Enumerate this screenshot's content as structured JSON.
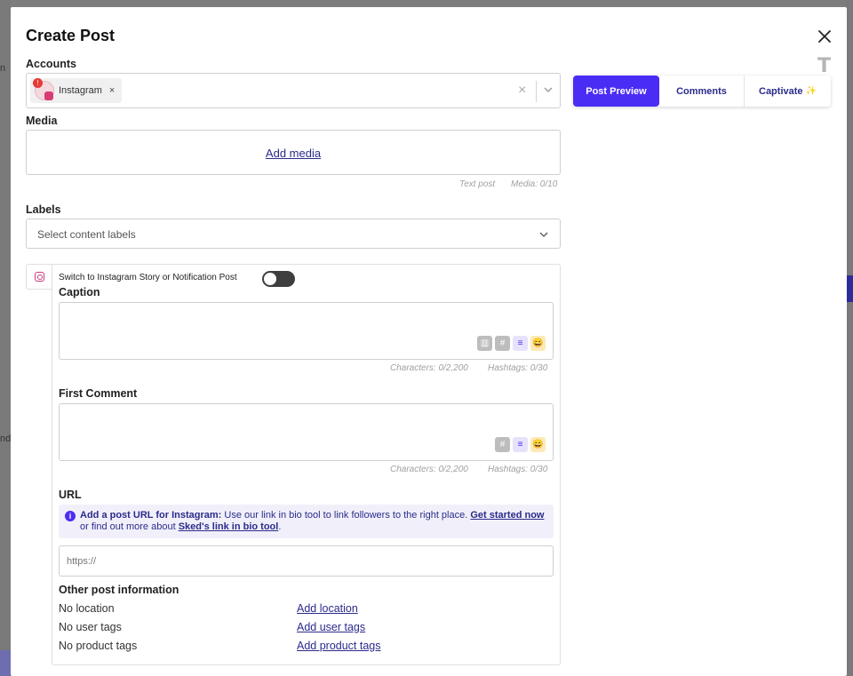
{
  "background": {
    "left_fragments": [
      "n",
      "nd"
    ]
  },
  "modal": {
    "title": "Create Post",
    "close_icon": "close-icon",
    "text_tool_icon": "T"
  },
  "accounts": {
    "label": "Accounts",
    "chip_label": "Instagram",
    "chip_badge": "!",
    "chip_remove": "×",
    "clear_symbol": "×"
  },
  "media": {
    "label": "Media",
    "add_media": "Add media",
    "post_type": "Text post",
    "media_count": "Media: 0/10"
  },
  "labels": {
    "label": "Labels",
    "placeholder": "Select content labels"
  },
  "preview_tabs": {
    "post_preview": "Post Preview",
    "comments": "Comments",
    "captivate": "Captivate",
    "captivate_sparkle": "✨",
    "active": "Post Preview",
    "accent_color": "#4a2df5"
  },
  "instagram": {
    "switch_label": "Switch to Instagram Story or Notification Post",
    "switch_on": false,
    "caption": {
      "label": "Caption",
      "characters": "Characters: 0/2,200",
      "hashtags": "Hashtags: 0/30"
    },
    "first_comment": {
      "label": "First Comment",
      "characters": "Characters: 0/2,200",
      "hashtags": "Hashtags: 0/30"
    },
    "url": {
      "label": "URL",
      "info_bold": "Add a post URL for Instagram:",
      "info_text_1": " Use our link in bio tool to link followers to the right place. ",
      "info_link_1": "Get started now",
      "info_text_2": " or find out more about ",
      "info_link_2": "Sked's link in bio tool",
      "info_text_3": ".",
      "placeholder": "https://"
    },
    "other": {
      "label": "Other post information",
      "rows": [
        {
          "status": "No location",
          "action": "Add location"
        },
        {
          "status": "No user tags",
          "action": "Add user tags"
        },
        {
          "status": "No product tags",
          "action": "Add product tags"
        }
      ]
    }
  }
}
